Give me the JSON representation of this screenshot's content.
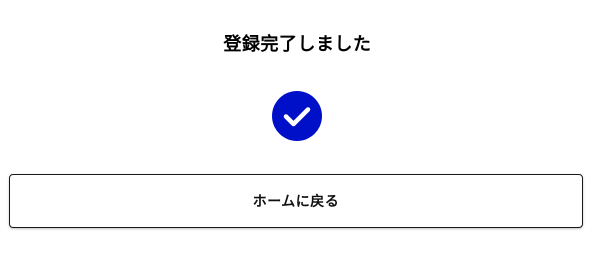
{
  "dialog": {
    "title": "登録完了しました",
    "status_icon": "check-circle-icon",
    "accent_color": "#0010c8"
  },
  "actions": {
    "home_label": "ホームに戻る"
  }
}
